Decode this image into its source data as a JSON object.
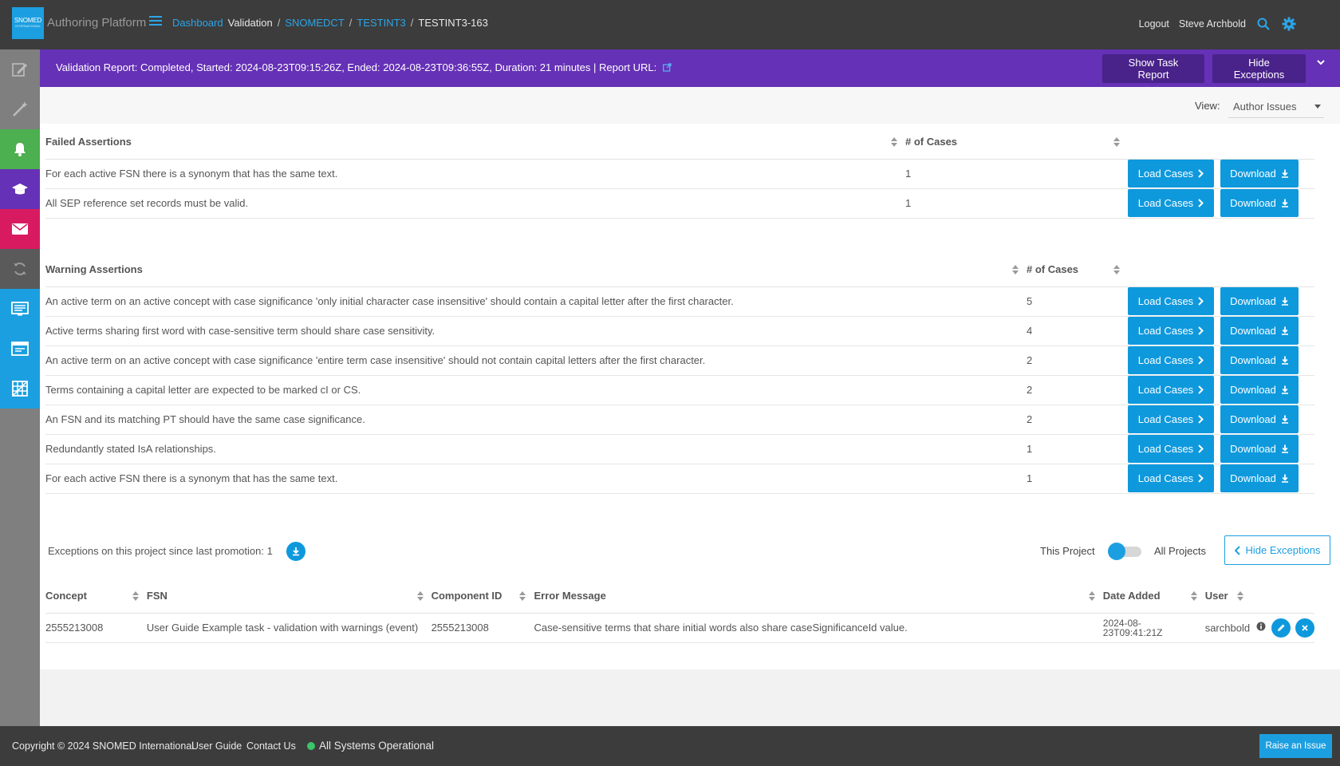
{
  "header": {
    "logo_text": "SNOMED",
    "logo_sub": "INTERNATIONAL",
    "app_title": "Authoring Platform",
    "breadcrumbs": {
      "dashboard": "Dashboard",
      "validation": "Validation",
      "codesystem": "SNOMEDCT",
      "project": "TESTINT3",
      "task": "TESTINT3-163",
      "separator": "/"
    },
    "logout": "Logout",
    "user_name": "Steve Archbold"
  },
  "sidebar": {
    "items": [
      {
        "icon": "edit-icon",
        "bg": "#7f7f7f"
      },
      {
        "icon": "magic-wand-icon",
        "bg": "#7f7f7f"
      },
      {
        "icon": "bell-icon",
        "bg": "#4caf50"
      },
      {
        "icon": "graduation-cap-icon",
        "bg": "#6531b6"
      },
      {
        "icon": "envelope-icon",
        "bg": "#d81b60"
      },
      {
        "icon": "sync-icon",
        "bg": "#5a5a5a"
      },
      {
        "icon": "list-panel-icon",
        "bg": "#1c9fe0"
      },
      {
        "icon": "browser-window-icon",
        "bg": "#1c9fe0"
      },
      {
        "icon": "grid-icon",
        "bg": "#1c9fe0"
      }
    ]
  },
  "banner": {
    "text": "Validation Report: Completed, Started: 2024-08-23T09:15:26Z, Ended: 2024-08-23T09:36:55Z, Duration: 21 minutes | Report URL:",
    "show_task_report": "Show Task Report",
    "hide_exceptions": "Hide Exceptions"
  },
  "view": {
    "label": "View:",
    "selected": "Author Issues"
  },
  "failed": {
    "header": "Failed Assertions",
    "count_header": "# of Cases",
    "rows": [
      {
        "text": "For each active FSN there is a synonym that has the same text.",
        "count": "1"
      },
      {
        "text": "All SEP reference set records must be valid.",
        "count": "1"
      }
    ]
  },
  "warning": {
    "header": "Warning Assertions",
    "count_header": "# of Cases",
    "rows": [
      {
        "text": "An active term on an active concept with case significance 'only initial character case insensitive' should contain a capital letter after the first character.",
        "count": "5"
      },
      {
        "text": "Active terms sharing first word with case-sensitive term should share case sensitivity.",
        "count": "4"
      },
      {
        "text": "An active term on an active concept with case significance 'entire term case insensitive' should not contain capital letters after the first character.",
        "count": "2"
      },
      {
        "text": "Terms containing a capital letter are expected to be marked cI or CS.",
        "count": "2"
      },
      {
        "text": "An FSN and its matching PT should have the same case significance.",
        "count": "2"
      },
      {
        "text": "Redundantly stated IsA relationships.",
        "count": "1"
      },
      {
        "text": "For each active FSN there is a synonym that has the same text.",
        "count": "1"
      }
    ]
  },
  "buttons": {
    "load_cases": "Load Cases",
    "download": "Download"
  },
  "exceptions": {
    "summary": "Exceptions on this project since last promotion: 1",
    "this_project": "This Project",
    "all_projects": "All Projects",
    "hide_button": "Hide Exceptions",
    "columns": [
      "Concept",
      "FSN",
      "Component ID",
      "Error Message",
      "Date Added",
      "User"
    ],
    "rows": [
      {
        "concept": "2555213008",
        "fsn": "User Guide Example task - validation with warnings (event)",
        "component_id": "2555213008",
        "error_message": "Case-sensitive terms that share initial words also share caseSignificanceId value.",
        "date_added_line1": "2024-08-",
        "date_added_line2": "23T09:41:21Z",
        "user": "sarchbold"
      }
    ]
  },
  "footer": {
    "copyright": "Copyright © 2024 SNOMED International",
    "user_guide": "User Guide",
    "contact_us": "Contact Us",
    "status": "All Systems Operational",
    "raise_issue": "Raise an Issue"
  }
}
